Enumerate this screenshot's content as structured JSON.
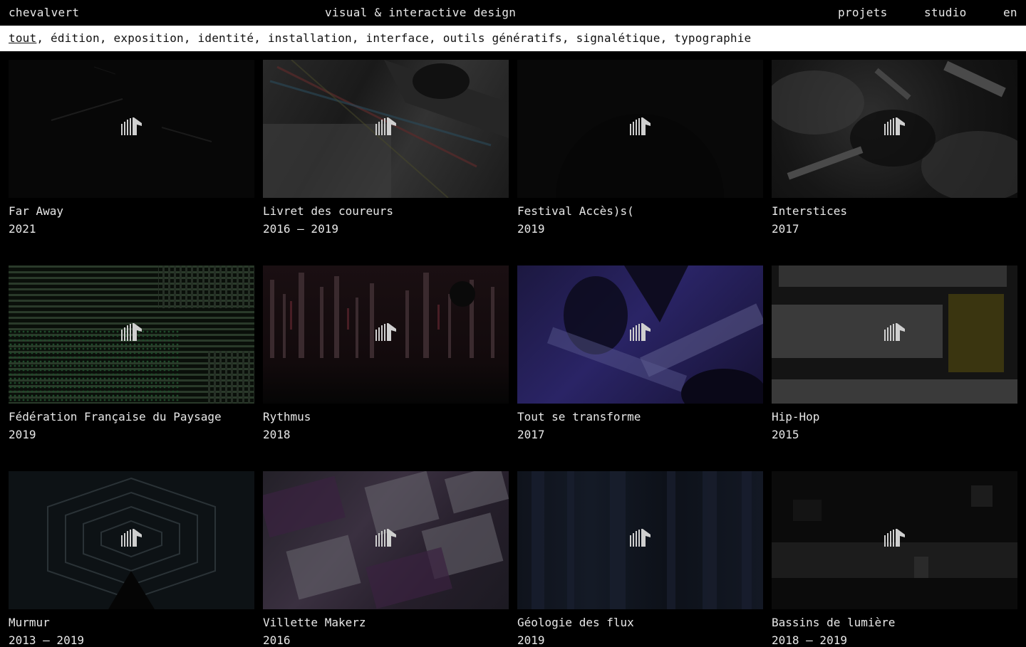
{
  "header": {
    "brand": "chevalvert",
    "tagline": "visual & interactive design",
    "nav": {
      "projets": "projets",
      "studio": "studio",
      "lang": "en"
    }
  },
  "filters": [
    {
      "label": "tout",
      "active": true
    },
    {
      "label": "édition"
    },
    {
      "label": "exposition"
    },
    {
      "label": "identité"
    },
    {
      "label": "installation"
    },
    {
      "label": "interface"
    },
    {
      "label": "outils génératifs"
    },
    {
      "label": "signalétique"
    },
    {
      "label": "typographie"
    }
  ],
  "filter_separator": ", ",
  "projects": [
    {
      "title": "Far Away",
      "year": "2021"
    },
    {
      "title": "Livret des coureurs",
      "year": "2016 — 2019"
    },
    {
      "title": "Festival Accès)s(",
      "year": "2019"
    },
    {
      "title": "Interstices",
      "year": "2017"
    },
    {
      "title": "Fédération Française du Paysage",
      "year": "2019"
    },
    {
      "title": "Rythmus",
      "year": "2018"
    },
    {
      "title": "Tout se transforme",
      "year": "2017"
    },
    {
      "title": "Hip-Hop",
      "year": "2015"
    },
    {
      "title": "Murmur",
      "year": "2013 — 2019"
    },
    {
      "title": "Villette Makerz",
      "year": "2016"
    },
    {
      "title": "Géologie des flux",
      "year": "2019"
    },
    {
      "title": "Bassins de lumière",
      "year": "2018 — 2019"
    }
  ],
  "colors": {
    "background": "#000000",
    "text": "#e8e8e8",
    "filter_bar": "#ffffff",
    "filter_text": "#111111"
  },
  "icons": {
    "card_overlay": "chevalvert-horse-logo-icon"
  }
}
